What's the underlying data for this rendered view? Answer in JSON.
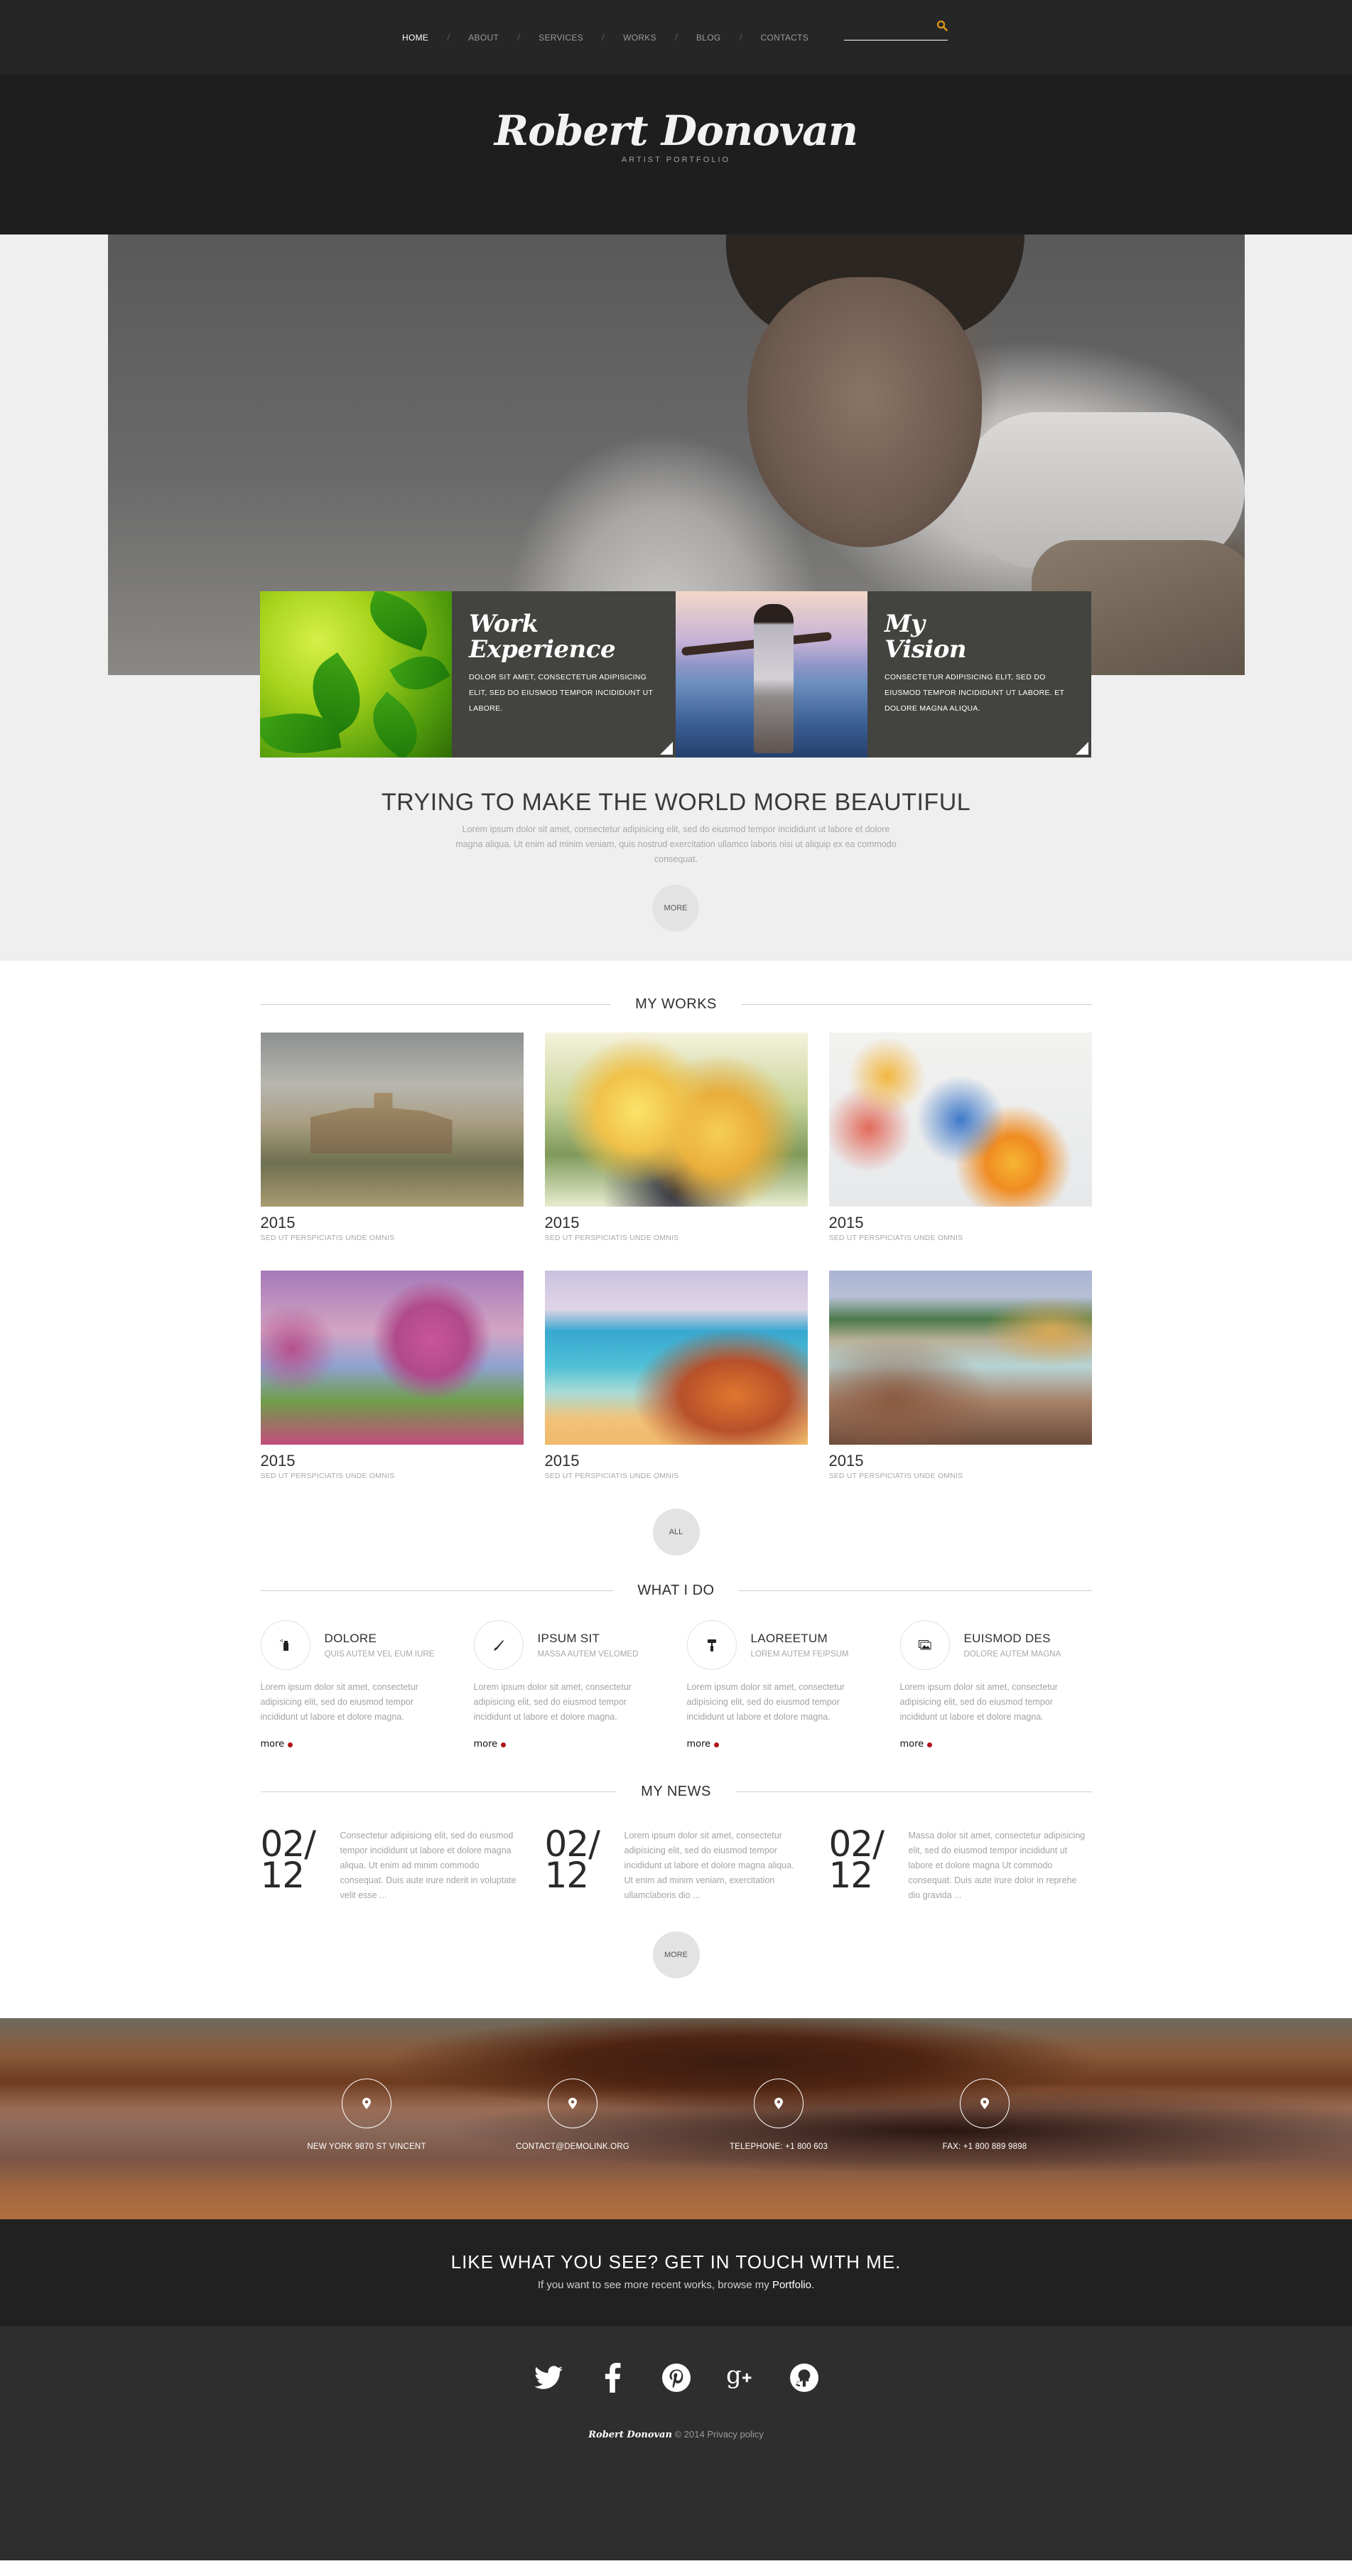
{
  "nav": {
    "items": [
      {
        "label": "HOME",
        "active": true
      },
      {
        "label": "ABOUT",
        "active": false
      },
      {
        "label": "SERVICES",
        "active": false
      },
      {
        "label": "WORKS",
        "active": false
      },
      {
        "label": "BLOG",
        "active": false
      },
      {
        "label": "CONTACTS",
        "active": false
      }
    ],
    "separator": "/",
    "search": {
      "value": "",
      "placeholder": "",
      "icon": "search-icon"
    }
  },
  "header": {
    "logo": "Robert Donovan",
    "subtitle": "ARTIST PORTFOLIO"
  },
  "hero": {
    "features": [
      {
        "title_line1": "Work",
        "title_line2": "Experience",
        "text": "DOLOR SIT AMET, CONSECTETUR ADIPISICING ELIT, SED DO EIUSMOD TEMPOR INCIDIDUNT UT LABORE."
      },
      {
        "title_line1": "My",
        "title_line2": "Vision",
        "text": "CONSECTETUR ADIPISICING ELIT, SED DO EIUSMOD TEMPOR INCIDIDUNT UT LABORE. ET DOLORE MAGNA ALIQUA."
      }
    ],
    "tagline": "TRYING TO MAKE THE WORLD MORE BEAUTIFUL",
    "intro": "Lorem ipsum dolor sit amet, consectetur adipisicing elit, sed do eiusmod tempor incididunt ut labore et dolore magna aliqua. Ut enim ad minim veniam, quis nostrud exercitation ullamco laboris nisi ut aliquip ex ea commodo consequat.",
    "more_label": "MORE"
  },
  "works": {
    "title": "MY WORKS",
    "items": [
      {
        "year": "2015",
        "caption": "SED UT PERSPICIATIS UNDE OMNIS"
      },
      {
        "year": "2015",
        "caption": "SED UT PERSPICIATIS UNDE OMNIS"
      },
      {
        "year": "2015",
        "caption": "SED UT PERSPICIATIS UNDE OMNIS"
      },
      {
        "year": "2015",
        "caption": "SED UT PERSPICIATIS UNDE OMNIS"
      },
      {
        "year": "2015",
        "caption": "SED UT PERSPICIATIS UNDE OMNIS"
      },
      {
        "year": "2015",
        "caption": "SED UT PERSPICIATIS UNDE OMNIS"
      }
    ],
    "all_label": "ALL"
  },
  "services": {
    "title": "WHAT I DO",
    "items": [
      {
        "icon": "spray-can-icon",
        "title": "DOLORE",
        "subtitle": "QUIS AUTEM VEL EUM IURE",
        "text": "Lorem ipsum dolor sit amet, consectetur adipisicing elit, sed do eiusmod tempor incididunt ut labore et dolore magna.",
        "more": "more"
      },
      {
        "icon": "brush-icon",
        "title": "IPSUM SIT",
        "subtitle": "MASSA AUTEM VELOMED",
        "text": "Lorem ipsum dolor sit amet, consectetur adipisicing elit, sed do eiusmod tempor incididunt ut labore et dolore magna.",
        "more": "more"
      },
      {
        "icon": "paint-roller-icon",
        "title": "LAOREETUM",
        "subtitle": "LOREM AUTEM FEIPSUM",
        "text": "Lorem ipsum dolor sit amet, consectetur adipisicing elit, sed do eiusmod tempor incididunt ut labore et dolore magna.",
        "more": "more"
      },
      {
        "icon": "pictures-icon",
        "title": "EUISMOD DES",
        "subtitle": "DOLORE AUTEM MAGNA",
        "text": "Lorem ipsum dolor sit amet, consectetur adipisicing elit, sed do eiusmod tempor incididunt ut labore et dolore magna.",
        "more": "more"
      }
    ]
  },
  "news": {
    "title": "MY NEWS",
    "items": [
      {
        "date_top": "02/",
        "date_bottom": "12",
        "text": "Consectetur adipisicing elit, sed do eiusmod tempor incididunt ut labore et dolore magna aliqua. Ut enim ad minim commodo consequat. Duis aute irure nderit in voluptate velit esse ..."
      },
      {
        "date_top": "02/",
        "date_bottom": "12",
        "text": "Lorem ipsum dolor sit amet, consectetur adipisicing elit, sed do eiusmod tempor incididunt ut labore et dolore magna aliqua. Ut enim ad minim veniam, exercitation ullamclaboris dio ..."
      },
      {
        "date_top": "02/",
        "date_bottom": "12",
        "text": "Massa dolor sit amet, consectetur adipisicing elit, sed do eiusmod tempor incididunt ut labore et dolore magna Ut commodo consequat. Duis aute irure dolor in reprehe dio gravida ..."
      }
    ],
    "more_label": "MORE"
  },
  "contacts": {
    "items": [
      {
        "icon": "map-pin-icon",
        "label": "NEW YORK 9870 ST VINCENT"
      },
      {
        "icon": "map-pin-icon",
        "label": "CONTACT@DEMOLINK.ORG"
      },
      {
        "icon": "map-pin-icon",
        "label": "TELEPHONE: +1 800 603"
      },
      {
        "icon": "map-pin-icon",
        "label": "FAX: +1 800 889 9898"
      }
    ]
  },
  "cta": {
    "title": "LIKE WHAT YOU SEE? GET IN TOUCH WITH ME.",
    "text_before": "If you want to see more recent works, browse my ",
    "link": "Portfolio",
    "text_after": "."
  },
  "footer": {
    "socials": [
      "twitter-icon",
      "facebook-icon",
      "pinterest-icon",
      "google-plus-icon",
      "github-icon"
    ],
    "brand": "Robert Donovan",
    "copyright": "© 2014",
    "privacy": "Privacy policy"
  },
  "colors": {
    "accent_search": "#e09a1a",
    "more_dot": "#b0151d",
    "feature_box": "#434340",
    "nav_bg": "#262626",
    "footer_bg": "#2e2e2e"
  }
}
